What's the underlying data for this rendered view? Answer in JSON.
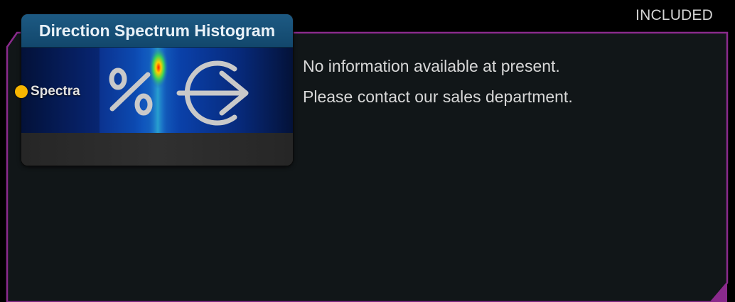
{
  "badge": {
    "text": "INCLUDED"
  },
  "node": {
    "title": "Direction Spectrum Histogram",
    "input_port": {
      "label": "Spectra",
      "color": "#f7b500"
    },
    "icon_symbols": [
      "percent-icon",
      "arrow-right-circle-icon"
    ]
  },
  "info": {
    "line1": "No information available at present.",
    "line2": "Please contact our sales department."
  },
  "colors": {
    "background": "#000000",
    "panel": "#111618",
    "frame_accent": "#8a2a8c",
    "header": "#1d5a83",
    "port": "#f7b500"
  }
}
